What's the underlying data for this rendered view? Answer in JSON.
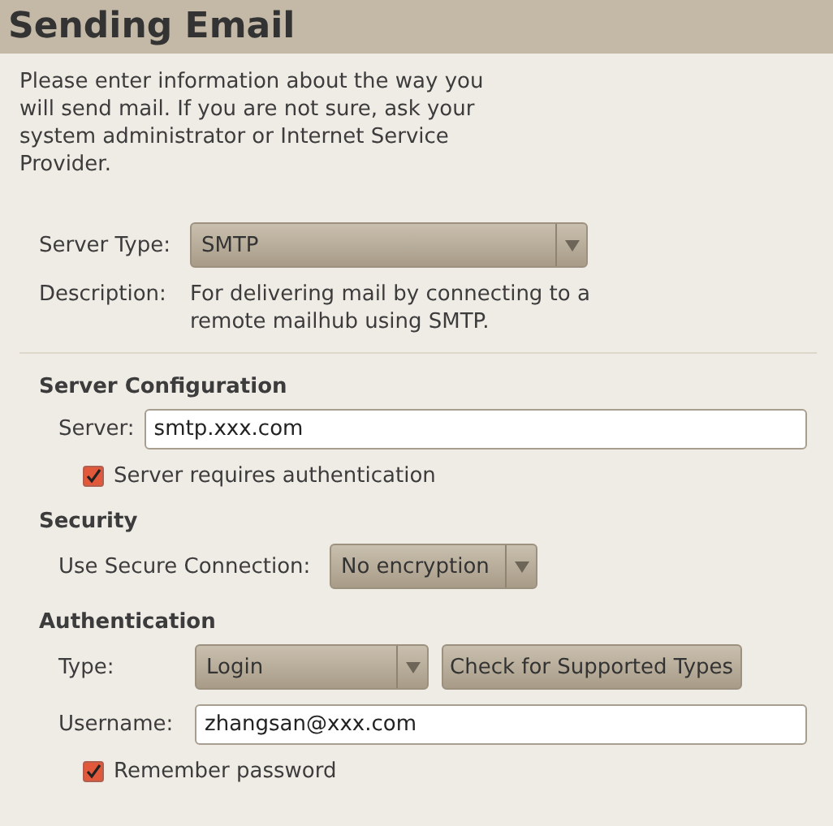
{
  "title": "Sending Email",
  "intro": "Please enter information about the way you will send mail. If you are not sure, ask your system administrator or Internet Service Provider.",
  "server_type": {
    "label": "Server Type:",
    "value": "SMTP"
  },
  "description": {
    "label": "Description:",
    "text": "For delivering mail by connecting to a remote mailhub using SMTP."
  },
  "server_configuration": {
    "heading": "Server Configuration",
    "server": {
      "label": "Server:",
      "value": "smtp.xxx.com"
    },
    "requires_auth": {
      "label": "Server requires authentication",
      "checked": true
    }
  },
  "security": {
    "heading": "Security",
    "connection": {
      "label": "Use Secure Connection:",
      "value": "No encryption"
    }
  },
  "authentication": {
    "heading": "Authentication",
    "type": {
      "label": "Type:",
      "value": "Login"
    },
    "check_button": "Check for Supported Types",
    "username": {
      "label": "Username:",
      "value": "zhangsan@xxx.com"
    },
    "remember": {
      "label": "Remember password",
      "checked": true
    }
  }
}
